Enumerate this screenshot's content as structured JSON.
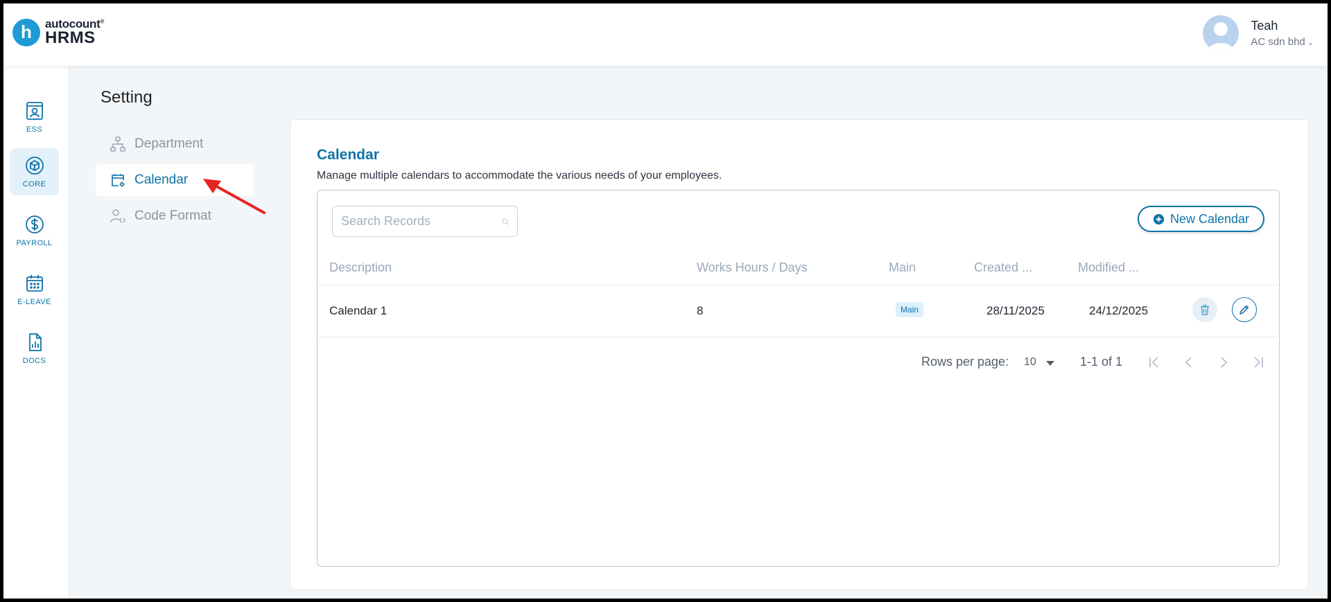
{
  "header": {
    "logo_letter": "h",
    "logo_top": "autocount",
    "logo_reg": "®",
    "logo_bottom": "HRMS",
    "user_name": "Teah",
    "company": "AC sdn bhd",
    "company_chevron": "⌄"
  },
  "rail": [
    {
      "label": "ESS",
      "icon": "id-card-icon"
    },
    {
      "label": "CORE",
      "icon": "cube-icon",
      "active": true
    },
    {
      "label": "PAYROLL",
      "icon": "dollar-circle-icon"
    },
    {
      "label": "E-LEAVE",
      "icon": "calendar-grid-icon"
    },
    {
      "label": "DOCS",
      "icon": "document-chart-icon"
    }
  ],
  "setting": {
    "title": "Setting",
    "items": [
      {
        "label": "Department",
        "icon": "org-chart-icon"
      },
      {
        "label": "Calendar",
        "icon": "calendar-gear-icon",
        "active": true
      },
      {
        "label": "Code Format",
        "icon": "user-code-icon"
      }
    ]
  },
  "card": {
    "title": "Calendar",
    "description": "Manage multiple calendars to accommodate the various needs of your employees.",
    "search_placeholder": "Search Records",
    "new_button": "New Calendar",
    "columns": [
      "Description",
      "Works Hours / Days",
      "Main",
      "Created ...",
      "Modified ..."
    ],
    "rows": [
      {
        "description": "Calendar 1",
        "hours": "8",
        "main": "Main",
        "created": "28/11/2025",
        "modified": "24/12/2025"
      }
    ],
    "pagination": {
      "rows_per_page_label": "Rows per page:",
      "rows_per_page": "10",
      "range": "1-1 of 1"
    }
  },
  "colors": {
    "brand": "#0e72a8",
    "logo": "#1e9ad6",
    "badge_bg": "#daf0fb",
    "annotation_arrow": "#e8231f"
  }
}
